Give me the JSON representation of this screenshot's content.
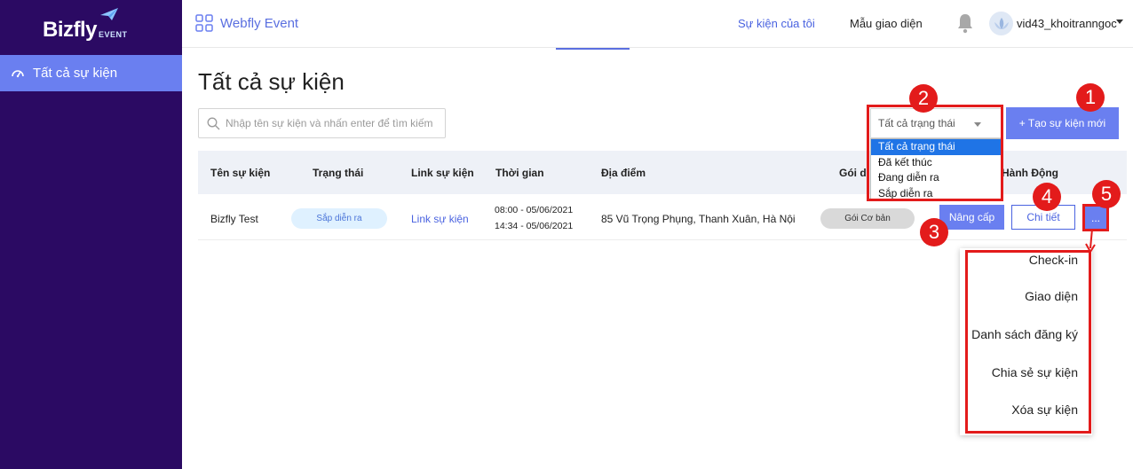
{
  "sidebar": {
    "logo_main": "Bizfly",
    "logo_sub": "EVENT",
    "items": [
      {
        "label": "Tất cả sự kiện",
        "icon": "gauge-icon"
      }
    ]
  },
  "topbar": {
    "app_name": "Webfly Event",
    "tabs": [
      {
        "label": "Sự kiện của tôi",
        "active": true
      },
      {
        "label": "Mẫu giao diện",
        "active": false
      }
    ],
    "username": "vid43_khoitranngoc"
  },
  "main": {
    "title": "Tất cả sự kiện",
    "search_placeholder": "Nhập tên sự kiện và nhấn enter để tìm kiếm",
    "status_filter": {
      "selected": "Tất cả trạng thái",
      "options": [
        "Tất cả trạng thái",
        "Đã kết thúc",
        "Đang diễn ra",
        "Sắp diễn ra"
      ]
    },
    "create_button": "+ Tạo sự kiện mới",
    "table": {
      "columns": [
        "Tên sự kiện",
        "Trạng thái",
        "Link sự kiện",
        "Thời gian",
        "Địa điểm",
        "Gói d",
        "Hành Động"
      ],
      "rows": [
        {
          "name": "Bizfly Test",
          "status": "Sắp diễn ra",
          "link": "Link sự kiện",
          "time_start": "08:00 - 05/06/2021",
          "time_end": "14:34 - 05/06/2021",
          "location": "85 Vũ Trọng Phụng, Thanh Xuân, Hà Nội",
          "package": "Gói Cơ bản",
          "upgrade": "Nâng cấp",
          "detail": "Chi tiết",
          "more": "..."
        }
      ]
    },
    "action_menu": [
      "Check-in",
      "Giao diện",
      "Danh sách đăng ký",
      "Chia sẻ sự kiện",
      "Xóa sự kiện"
    ]
  },
  "annotations": [
    "1",
    "2",
    "3",
    "4",
    "5"
  ],
  "colors": {
    "sidebar_bg": "#2b0a63",
    "accent": "#6a7ff0",
    "annotation_red": "#e31b1b",
    "dropdown_selected": "#1f74e6"
  }
}
